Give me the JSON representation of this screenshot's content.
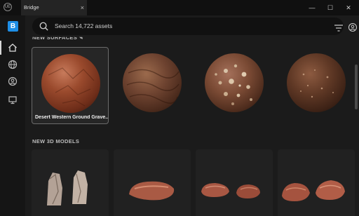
{
  "window": {
    "tab_title": "Bridge",
    "tab_close": "×",
    "minimize": "—",
    "maximize": "☐",
    "close": "✕",
    "app_logo": "UE"
  },
  "sidebar": {
    "brand_letter": "B",
    "brand_color": "#1e8ee6",
    "items": [
      {
        "icon": "home-icon"
      },
      {
        "icon": "globe-icon"
      },
      {
        "icon": "user-circle-icon"
      },
      {
        "icon": "monitor-icon"
      }
    ]
  },
  "search": {
    "placeholder": "Search 14,722 assets"
  },
  "surfaces": {
    "title": "NEW SURFACES",
    "items": [
      {
        "label": "Desert Western Ground Grave...",
        "selected": true,
        "color": "#8a3f24"
      },
      {
        "label": "",
        "selected": false,
        "color": "#6a3d27"
      },
      {
        "label": "",
        "selected": false,
        "color": "#7d4a33"
      },
      {
        "label": "",
        "selected": false,
        "color": "#5a3422"
      }
    ]
  },
  "models": {
    "title": "NEW 3D MODELS",
    "items": [
      {
        "name": "rock-pillars-model"
      },
      {
        "name": "red-stone-model"
      },
      {
        "name": "red-stones-pair-model"
      },
      {
        "name": "red-rocks-pair-model"
      }
    ]
  }
}
